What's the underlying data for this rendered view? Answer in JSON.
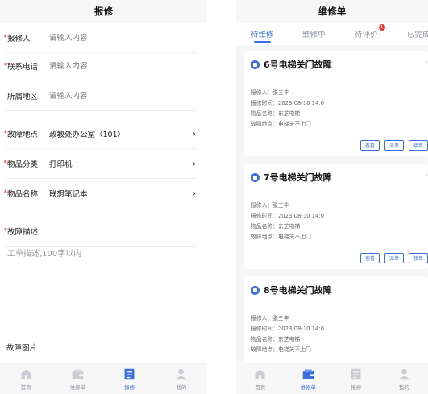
{
  "left_screen": {
    "title": "报修",
    "fields": [
      {
        "label": "报修人",
        "required": true,
        "placeholder": "请输入内容",
        "value": ""
      },
      {
        "label": "联系电话",
        "required": true,
        "placeholder": "请输入内容",
        "value": ""
      },
      {
        "label": "所属地区",
        "required": false,
        "placeholder": "请输入内容",
        "value": ""
      },
      {
        "label": "故障地点",
        "required": true,
        "value": "政教处办公室（101）",
        "chevron": true
      },
      {
        "label": "物品分类",
        "required": true,
        "value": "打印机",
        "chevron": true
      },
      {
        "label": "物品名称",
        "required": true,
        "value": "联想笔记本",
        "chevron": true
      },
      {
        "label": "故障描述",
        "required": true
      }
    ],
    "description_placeholder": "工单描述,100字以内",
    "images_label": "故障图片",
    "required_mark": "*",
    "tabbar": [
      "首页",
      "维修单",
      "报修",
      "我的"
    ],
    "active_tab": "报修"
  },
  "right_screen": {
    "title": "维修单",
    "tabs": [
      "待维修",
      "维修中",
      "待评价",
      "已完成"
    ],
    "active_tab": "维修单",
    "badge_count": "1",
    "cards": [
      {
        "title": "6号电梯关门故障",
        "reporter": "报修人：张三丰",
        "time": "报修时间：2023-08-10 14:0",
        "item": "物品名称：东芝电梯",
        "location": "故障地点：电梯关不上门",
        "buttons": [
          "查看",
          "派单",
          "接单"
        ]
      },
      {
        "title": "7号电梯关门故障",
        "reporter": "报修人：张三丰",
        "time": "报修时间：2023-08-10 14:0",
        "item": "物品名称：东芝电梯",
        "location": "故障地点：电梯关不上门",
        "buttons": [
          "查看",
          "派单",
          "接单"
        ]
      },
      {
        "title": "8号电梯关门故障",
        "reporter": "报修人：张三丰",
        "time": "报修时间：2023-08-10 14:0",
        "item": "物品名称：东芝电梯",
        "location": "故障地点：电梯关不上门",
        "buttons": []
      }
    ],
    "tabbar": [
      "首页",
      "维修单",
      "报修",
      "我的"
    ]
  },
  "colors": {
    "accent": "#3b6fe0",
    "required": "#e53935",
    "badge": "#e53935"
  },
  "icons": [
    "home-icon",
    "wallet-icon",
    "report-icon",
    "user-icon",
    "chevron-right-icon",
    "status-dot-icon"
  ]
}
